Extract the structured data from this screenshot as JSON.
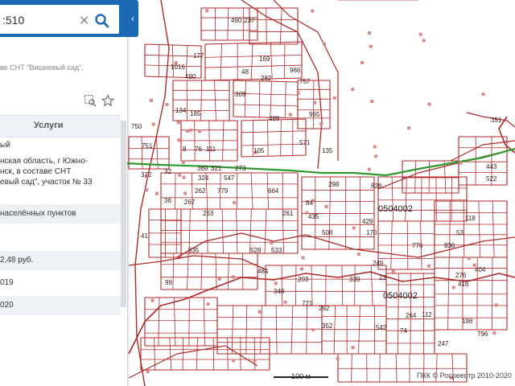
{
  "search": {
    "value": ":510",
    "clear_icon": "close-icon",
    "submit_icon": "search-icon"
  },
  "panel": {
    "address_partial": "ве СНТ \"Вишневый сад\",",
    "tools": [
      "zoom-to-object-icon",
      "bookmark-star-icon"
    ],
    "tab_services": "Услуги",
    "rows": [
      {
        "text": "ый",
        "highlight": false
      },
      {
        "text": "нская область, г Южно-",
        "highlight": false
      },
      {
        "text": "нск, в составе СНТ",
        "highlight": false
      },
      {
        "text": "евый сад\", участок № 33",
        "highlight": false
      },
      {
        "text": "населённых пунктов",
        "highlight": true
      },
      {
        "text": "2,48 руб.",
        "highlight": true
      },
      {
        "text": "019",
        "highlight": false
      },
      {
        "text": "020",
        "highlight": true
      }
    ],
    "collapse_icon": "chevron-left-icon"
  },
  "map": {
    "parcel_labels": [
      "490",
      "237",
      "177",
      "1016",
      "169",
      "480",
      "48",
      "282",
      "966",
      "757",
      "309",
      "134",
      "489",
      "185",
      "965",
      "751",
      "8",
      "76",
      "111",
      "105",
      "571",
      "135",
      "750",
      "369",
      "321",
      "273",
      "32",
      "324",
      "547",
      "298",
      "828",
      "372",
      "36",
      "262",
      "779",
      "664",
      "267",
      "263",
      "261",
      "84",
      "435",
      "429",
      "170",
      "118",
      "535",
      "528",
      "533",
      "508",
      "41",
      "776",
      "836",
      "53",
      "249",
      "404",
      "276",
      "416",
      "99",
      "484",
      "203",
      "339",
      "23",
      "348",
      "721",
      "292",
      "352",
      "542",
      "264",
      "112",
      "198",
      "247",
      "74",
      "796",
      "351",
      "443",
      "522",
      "0504002"
    ],
    "quarter_labels": [
      "0504002",
      "0504002"
    ],
    "scale_label": "100 м",
    "attribution": "ПКК © Росреестр 2010-2020",
    "colors": {
      "parcel": "#b02828",
      "boundary": "#2e9a2e",
      "panel_accent": "#1b68b3"
    }
  }
}
